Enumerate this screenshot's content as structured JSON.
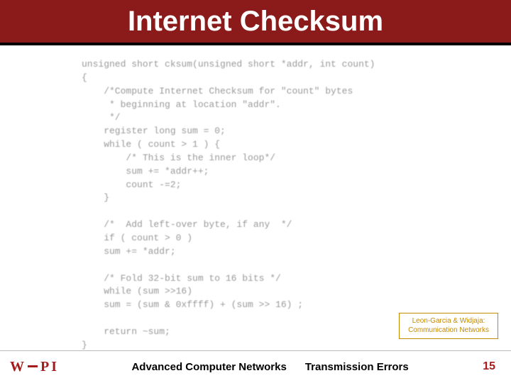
{
  "title": "Internet Checksum",
  "code": "unsigned short cksum(unsigned short *addr, int count)\n{\n    /*Compute Internet Checksum for \"count\" bytes\n     * beginning at location \"addr\".\n     */\n    register long sum = 0;\n    while ( count > 1 ) {\n        /* This is the inner loop*/\n        sum += *addr++;\n        count -=2;\n    }\n\n    /*  Add left-over byte, if any  */\n    if ( count > 0 )\n    sum += *addr;\n\n    /* Fold 32-bit sum to 16 bits */\n    while (sum >>16)\n    sum = (sum & 0xffff) + (sum >> 16) ;\n\n    return ~sum;\n}",
  "citation": {
    "line1": "Leon-Garcia & Widjaja:",
    "line2": "Communication Networks"
  },
  "footer": {
    "course": "Advanced Computer Networks",
    "topic": "Transmission Errors",
    "page": "15",
    "logo_text": "WPI"
  }
}
